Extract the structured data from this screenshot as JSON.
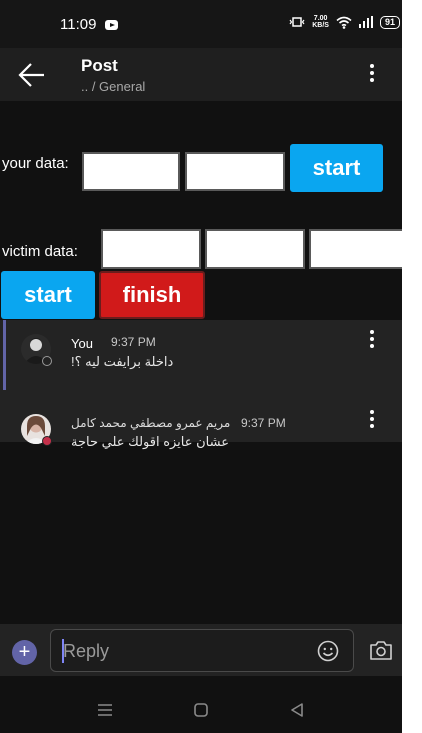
{
  "status_bar": {
    "time": "11:09",
    "speed_value": "7.00",
    "speed_unit": "KB/S",
    "battery": "91"
  },
  "header": {
    "title": "Post",
    "breadcrumb": ".. / General"
  },
  "form": {
    "your_data_label": "your data:",
    "victim_data_label": "victim data:",
    "start_label": "start",
    "finish_label": "finish"
  },
  "messages": [
    {
      "sender": "You",
      "time": "9:37 PM",
      "text": "داخلة برايفت ليه ؟!"
    },
    {
      "sender": "مريم عمرو مصطفي محمد كامل",
      "time": "9:37 PM",
      "text": "عشان عايزه اقولك علي حاجة"
    }
  ],
  "composer": {
    "placeholder": "Reply"
  },
  "colors": {
    "accent": "#6264a7",
    "start_button": "#0aa6f0",
    "finish_button": "#d11a1a"
  }
}
